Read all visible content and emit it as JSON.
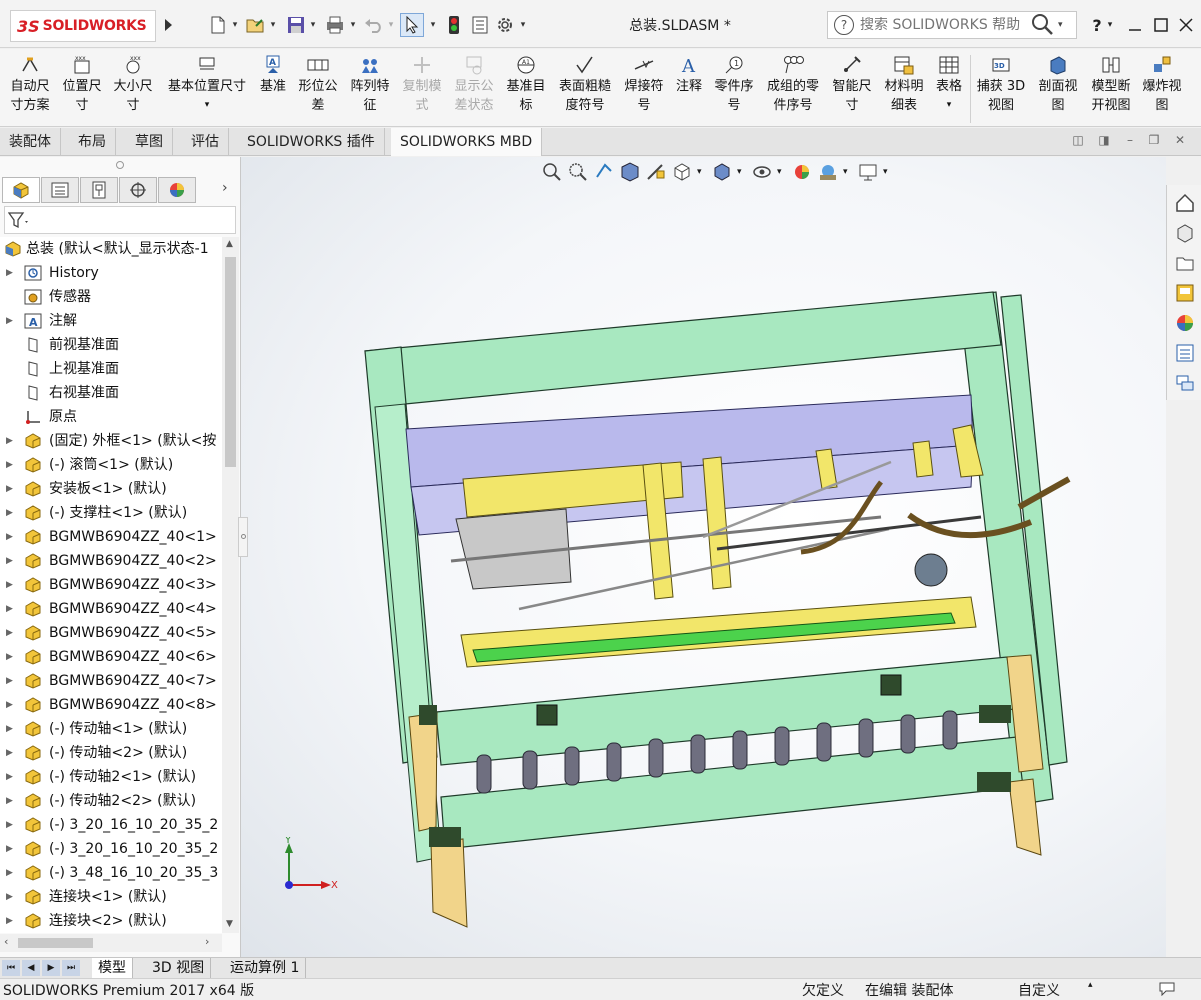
{
  "titlebar": {
    "logo_ds": "3S",
    "logo_text": "SOLIDWORKS",
    "document_title": "总装.SLDASM *",
    "search_placeholder": "搜索 SOLIDWORKS 帮助",
    "help_menu": "?"
  },
  "ribbon": {
    "items": [
      {
        "label1": "自动尺",
        "label2": "寸方案"
      },
      {
        "label1": "位置尺",
        "label2": "寸"
      },
      {
        "label1": "大小尺",
        "label2": "寸"
      },
      {
        "label1": "基本位置尺寸",
        "label2": ""
      },
      {
        "label1": "基准",
        "label2": ""
      },
      {
        "label1": "形位公",
        "label2": "差"
      },
      {
        "label1": "阵列特",
        "label2": "征"
      },
      {
        "label1": "复制模",
        "label2": "式"
      },
      {
        "label1": "显示公",
        "label2": "差状态"
      },
      {
        "label1": "基准目",
        "label2": "标"
      },
      {
        "label1": "表面粗糙",
        "label2": "度符号"
      },
      {
        "label1": "焊接符",
        "label2": "号"
      },
      {
        "label1": "注释",
        "label2": ""
      },
      {
        "label1": "零件序",
        "label2": "号"
      },
      {
        "label1": "成组的零",
        "label2": "件序号"
      },
      {
        "label1": "智能尺",
        "label2": "寸"
      },
      {
        "label1": "材料明",
        "label2": "细表"
      },
      {
        "label1": "表格",
        "label2": ""
      },
      {
        "label1": "捕获 3D",
        "label2": "视图"
      },
      {
        "label1": "剖面视",
        "label2": "图"
      },
      {
        "label1": "模型断",
        "label2": "开视图"
      },
      {
        "label1": "爆炸视",
        "label2": "图"
      }
    ]
  },
  "command_tabs": [
    "装配体",
    "布局",
    "草图",
    "评估",
    "SOLIDWORKS 插件",
    "SOLIDWORKS MBD"
  ],
  "tree": {
    "root": "总装  (默认<默认_显示状态-1",
    "items": [
      "History",
      "传感器",
      "注解",
      "前视基准面",
      "上视基准面",
      "右视基准面",
      "原点",
      "(固定) 外框<1> (默认<按",
      "(-) 滚筒<1> (默认)",
      "安装板<1> (默认)",
      "(-) 支撑柱<1> (默认)",
      "BGMWB6904ZZ_40<1>",
      "BGMWB6904ZZ_40<2>",
      "BGMWB6904ZZ_40<3>",
      "BGMWB6904ZZ_40<4>",
      "BGMWB6904ZZ_40<5>",
      "BGMWB6904ZZ_40<6>",
      "BGMWB6904ZZ_40<7>",
      "BGMWB6904ZZ_40<8>",
      "(-) 传动轴<1> (默认)",
      "(-) 传动轴<2> (默认)",
      "(-) 传动轴2<1> (默认)",
      "(-) 传动轴2<2> (默认)",
      "(-) 3_20_16_10_20_35_2",
      "(-) 3_20_16_10_20_35_2",
      "(-) 3_48_16_10_20_35_3",
      "连接块<1> (默认)",
      "连接块<2> (默认)"
    ]
  },
  "triad": {
    "y": "Y",
    "x": "X"
  },
  "bottom_tabs": [
    "模型",
    "3D 视图",
    "运动算例 1"
  ],
  "status": {
    "product": "SOLIDWORKS Premium 2017 x64 版",
    "defined": "欠定义",
    "editing": "在编辑 装配体",
    "custom": "自定义"
  },
  "colors": {
    "frame_green": "#a8e8c0",
    "plate_blue": "#b9b9ec",
    "part_yellow": "#f2e66a",
    "leg_tan": "#f1d48a",
    "dark_green_bracket": "#2f4a2c",
    "conveyor_green": "#4cd24c",
    "brand_red": "#d81f26"
  }
}
